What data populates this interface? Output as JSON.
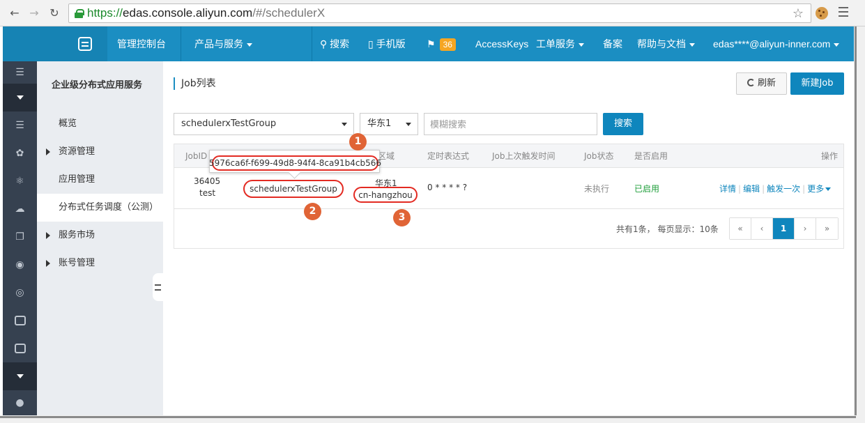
{
  "browser": {
    "url_scheme": "https://",
    "url_host": "edas.console.aliyun.com",
    "url_path": "/#/schedulerX"
  },
  "topbar": {
    "console": "管理控制台",
    "products": "产品与服务",
    "search": "搜索",
    "mobile": "手机版",
    "notifications": "36",
    "accesskeys": "AccessKeys",
    "tickets": "工单服务",
    "beian": "备案",
    "help": "帮助与文档",
    "user": "edas****@aliyun-inner.com"
  },
  "subnav": {
    "title": "企业级分布式应用服务",
    "items": [
      {
        "label": "概览"
      },
      {
        "label": "资源管理"
      },
      {
        "label": "应用管理"
      },
      {
        "label": "分布式任务调度（公测）"
      },
      {
        "label": "服务市场"
      },
      {
        "label": "账号管理"
      }
    ]
  },
  "main": {
    "title": "Job列表",
    "refresh": "刷新",
    "new_job": "新建Job",
    "group_select": "schedulerxTestGroup",
    "region_select": "华东1",
    "search_placeholder": "模糊搜索",
    "search_button": "搜索"
  },
  "table": {
    "headers": {
      "jobid": "JobID",
      "region": "区域",
      "cron": "定时表达式",
      "last_trigger": "Job上次触发时间",
      "status": "Job状态",
      "enabled": "是否启用",
      "ops": "操作"
    },
    "rows": [
      {
        "jobid": "36405",
        "name": "test",
        "group": "schedulerxTestGroup",
        "region_name": "华东1",
        "region_id": "cn-hangzhou",
        "cron": "0 * * * * ?",
        "status": "未执行",
        "enabled": "已启用",
        "op_detail": "详情",
        "op_edit": "编辑",
        "op_trigger": "触发一次",
        "op_more": "更多"
      }
    ]
  },
  "pagination": {
    "summary": "共有1条， 每页显示：10条",
    "first": "«",
    "prev": "‹",
    "current": "1",
    "next": "›",
    "last": "»"
  },
  "annotations": {
    "tooltip_id": "5976ca6f-f699-49d8-94f4-8ca91b4cb566",
    "m1": "1",
    "m2": "2",
    "m3": "3"
  },
  "colors": {
    "topbar": "#1b8ec2",
    "primary": "#0f86bd",
    "rail": "#364150",
    "highlight": "#e32a22",
    "marker": "#e06436"
  }
}
